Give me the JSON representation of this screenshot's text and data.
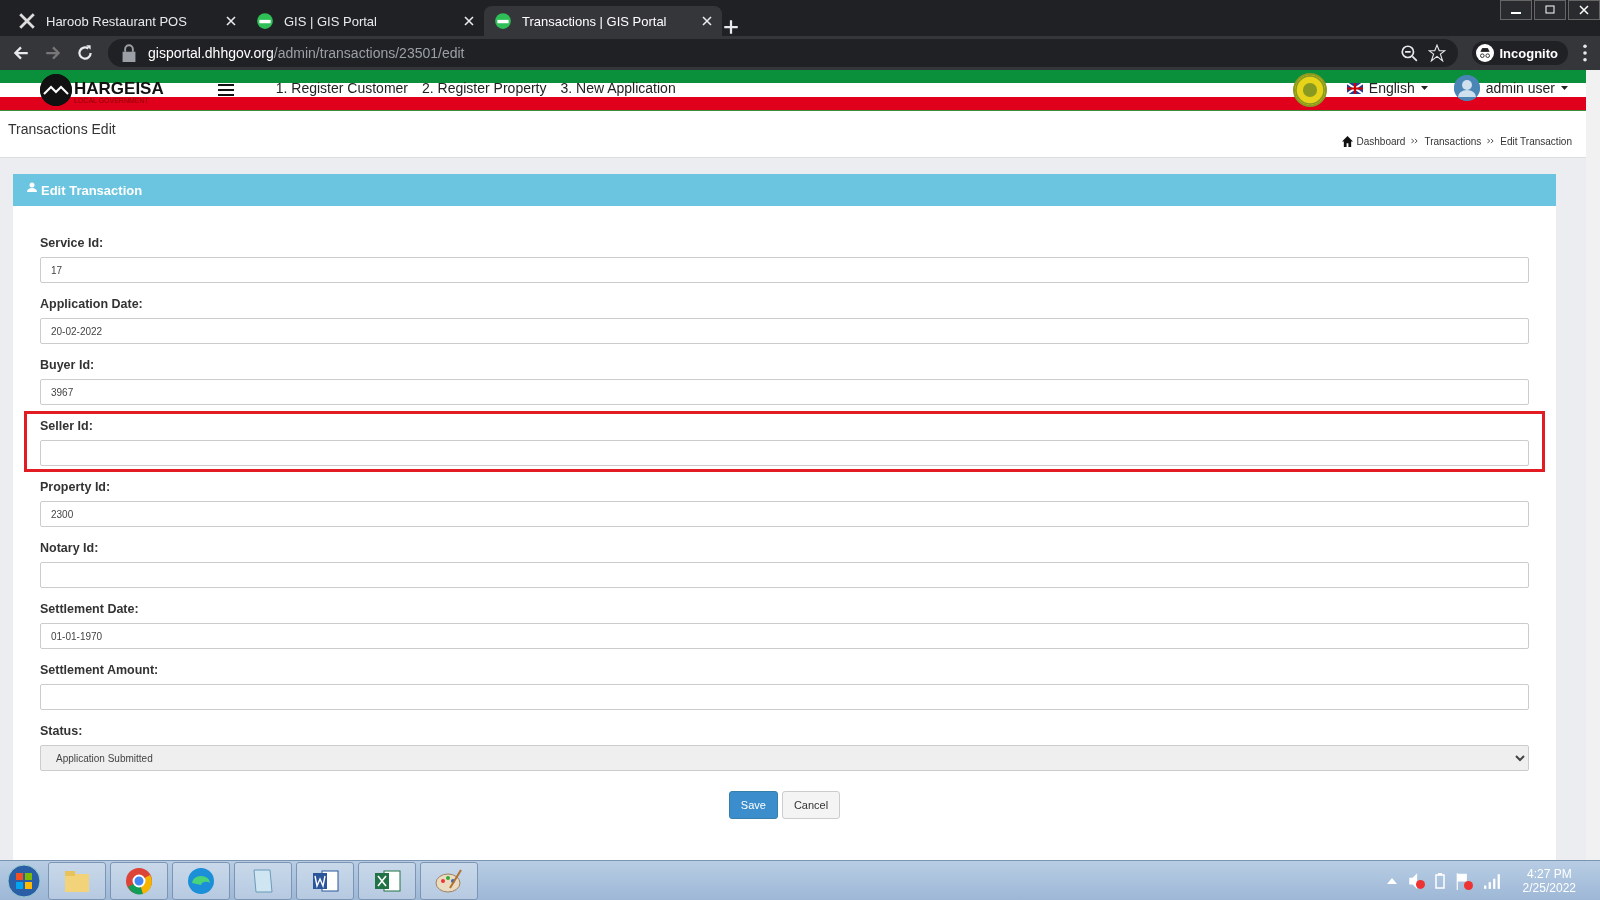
{
  "browser": {
    "tabs": [
      {
        "title": "Haroob Restaurant POS",
        "selected": false
      },
      {
        "title": "GIS | GIS Portal",
        "selected": false
      },
      {
        "title": "Transactions | GIS Portal",
        "selected": true
      }
    ],
    "url_host": "gisportal.dhhgov.org",
    "url_path": "/admin/transactions/23501/edit",
    "profile": "Incognito"
  },
  "navbar": {
    "logo_title": "HARGEISA",
    "logo_subtitle": "LOCAL GOVERNMENT",
    "links": [
      "1. Register Customer",
      "2. Register Property",
      "3. New Application"
    ],
    "language": "English",
    "user": "admin user"
  },
  "page_title": "Transactions Edit",
  "breadcrumb": [
    "Dashboard",
    "Transactions",
    "Edit Transaction"
  ],
  "panel": {
    "title": "Edit Transaction",
    "fields": [
      {
        "label": "Service Id:",
        "kind": "text",
        "value": "17",
        "highlighted": false
      },
      {
        "label": "Application Date:",
        "kind": "text",
        "value": "20-02-2022",
        "highlighted": false
      },
      {
        "label": "Buyer Id:",
        "kind": "text",
        "value": "3967",
        "highlighted": false
      },
      {
        "label": "Seller Id:",
        "kind": "text",
        "highlighted": true
      },
      {
        "label": "Property Id:",
        "kind": "text",
        "value": "2300",
        "highlighted": false
      },
      {
        "label": "Notary Id:",
        "kind": "text",
        "highlighted": false
      },
      {
        "label": "Settlement Date:",
        "kind": "text",
        "value": "01-01-1970",
        "highlighted": false
      },
      {
        "label": "Settlement Amount:",
        "kind": "text",
        "highlighted": false
      },
      {
        "label": "Status:",
        "kind": "select",
        "value": "Application Submitted",
        "highlighted": false
      }
    ],
    "buttons": [
      {
        "label": "Save",
        "kind": "primary"
      },
      {
        "label": "Cancel",
        "kind": "default"
      }
    ]
  },
  "taskbar": {
    "time": "4:27 PM",
    "date": "2/25/2022"
  }
}
